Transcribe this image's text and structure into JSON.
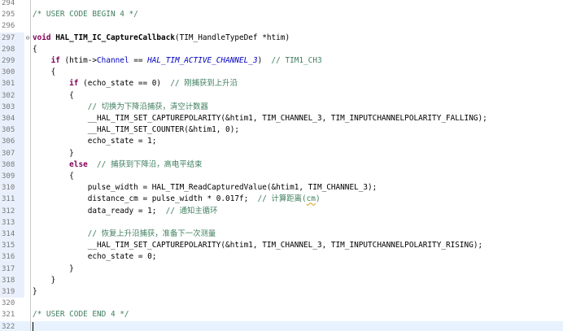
{
  "editor": {
    "lines": [
      {
        "num": "294",
        "tokens": []
      },
      {
        "num": "295",
        "tokens": [
          {
            "t": "/* USER CODE BEGIN 4 */",
            "c": "cm"
          }
        ]
      },
      {
        "num": "296",
        "tokens": []
      },
      {
        "num": "297",
        "fold": "⊖",
        "tokens": [
          {
            "t": "void ",
            "c": "kw"
          },
          {
            "t": "HAL_TIM_IC_CaptureCallback",
            "c": "fn"
          },
          {
            "t": "(TIM_HandleTypeDef *htim)",
            "c": ""
          }
        ]
      },
      {
        "num": "298",
        "tokens": [
          {
            "t": "{",
            "c": ""
          }
        ]
      },
      {
        "num": "299",
        "tokens": [
          {
            "t": "    ",
            "c": ""
          },
          {
            "t": "if",
            "c": "kw"
          },
          {
            "t": " (htim->",
            "c": ""
          },
          {
            "t": "Channel",
            "c": "field"
          },
          {
            "t": " == ",
            "c": ""
          },
          {
            "t": "HAL_TIM_ACTIVE_CHANNEL_3",
            "c": "const"
          },
          {
            "t": ")  ",
            "c": ""
          },
          {
            "t": "// TIM1_CH3",
            "c": "cm"
          }
        ]
      },
      {
        "num": "300",
        "tokens": [
          {
            "t": "    {",
            "c": ""
          }
        ]
      },
      {
        "num": "301",
        "tokens": [
          {
            "t": "        ",
            "c": ""
          },
          {
            "t": "if",
            "c": "kw"
          },
          {
            "t": " (echo_state == 0)  ",
            "c": ""
          },
          {
            "t": "// 刚捕获到上升沿",
            "c": "cm"
          }
        ]
      },
      {
        "num": "302",
        "tokens": [
          {
            "t": "        {",
            "c": ""
          }
        ]
      },
      {
        "num": "303",
        "tokens": [
          {
            "t": "            ",
            "c": ""
          },
          {
            "t": "// 切换为下降沿捕获，清空计数器",
            "c": "cm"
          }
        ]
      },
      {
        "num": "304",
        "tokens": [
          {
            "t": "            __HAL_TIM_SET_CAPTUREPOLARITY(&htim1, TIM_CHANNEL_3, TIM_INPUTCHANNELPOLARITY_FALLING);",
            "c": ""
          }
        ]
      },
      {
        "num": "305",
        "tokens": [
          {
            "t": "            __HAL_TIM_SET_COUNTER(&htim1, 0);",
            "c": ""
          }
        ]
      },
      {
        "num": "306",
        "tokens": [
          {
            "t": "            echo_state = 1;",
            "c": ""
          }
        ]
      },
      {
        "num": "307",
        "tokens": [
          {
            "t": "        }",
            "c": ""
          }
        ]
      },
      {
        "num": "308",
        "tokens": [
          {
            "t": "        ",
            "c": ""
          },
          {
            "t": "else",
            "c": "kw"
          },
          {
            "t": "  ",
            "c": ""
          },
          {
            "t": "// 捕获到下降沿，高电平结束",
            "c": "cm"
          }
        ]
      },
      {
        "num": "309",
        "tokens": [
          {
            "t": "        {",
            "c": ""
          }
        ]
      },
      {
        "num": "310",
        "tokens": [
          {
            "t": "            pulse_width = HAL_TIM_ReadCapturedValue(&htim1, TIM_CHANNEL_3);",
            "c": ""
          }
        ]
      },
      {
        "num": "311",
        "tokens": [
          {
            "t": "            distance_cm = pulse_width * 0.017f;  ",
            "c": ""
          },
          {
            "t": "// 计算距离(",
            "c": "cm"
          },
          {
            "t": "cm",
            "c": "squig"
          },
          {
            "t": ")",
            "c": "cm"
          }
        ]
      },
      {
        "num": "312",
        "tokens": [
          {
            "t": "            data_ready = 1;  ",
            "c": ""
          },
          {
            "t": "// 通知主循环",
            "c": "cm"
          }
        ]
      },
      {
        "num": "313",
        "tokens": []
      },
      {
        "num": "314",
        "tokens": [
          {
            "t": "            ",
            "c": ""
          },
          {
            "t": "// 恢复上升沿捕获，准备下一次测量",
            "c": "cm"
          }
        ]
      },
      {
        "num": "315",
        "tokens": [
          {
            "t": "            __HAL_TIM_SET_CAPTUREPOLARITY(&htim1, TIM_CHANNEL_3, TIM_INPUTCHANNELPOLARITY_RISING);",
            "c": ""
          }
        ]
      },
      {
        "num": "316",
        "tokens": [
          {
            "t": "            echo_state = 0;",
            "c": ""
          }
        ]
      },
      {
        "num": "317",
        "tokens": [
          {
            "t": "        }",
            "c": ""
          }
        ]
      },
      {
        "num": "318",
        "tokens": [
          {
            "t": "    }",
            "c": ""
          }
        ]
      },
      {
        "num": "319",
        "tokens": [
          {
            "t": "}",
            "c": ""
          }
        ]
      },
      {
        "num": "320",
        "tokens": []
      },
      {
        "num": "321",
        "tokens": [
          {
            "t": "/* USER CODE END 4 */",
            "c": "cm"
          }
        ]
      },
      {
        "num": "322",
        "current": true,
        "tokens": []
      }
    ]
  }
}
